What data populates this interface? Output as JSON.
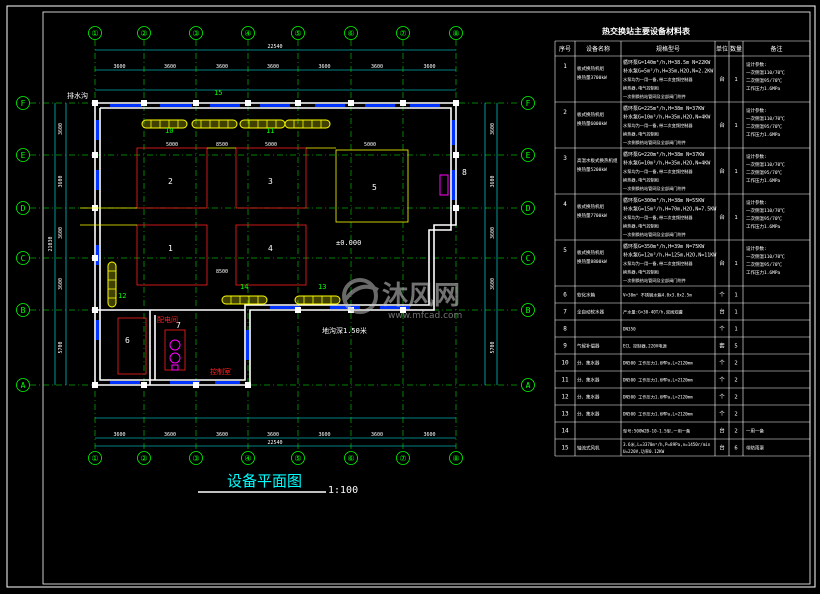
{
  "drawing": {
    "grid_columns": [
      "①",
      "②",
      "③",
      "④",
      "⑤",
      "⑥",
      "⑦",
      "⑧"
    ],
    "grid_rows": [
      "F",
      "E",
      "D",
      "C",
      "B",
      "A"
    ],
    "overall_width_dim": "22540",
    "top_dims": [
      "3600",
      "3600",
      "3600",
      "3600",
      "3600",
      "3600",
      "3600"
    ],
    "bottom_dims": [
      "3600",
      "3600",
      "3600",
      "3600",
      "3600",
      "3600",
      "3600"
    ],
    "left_dims": [
      "3600",
      "3600",
      "3600",
      "3600",
      "5700"
    ],
    "left_total": "21030",
    "right_dims": [
      "3600",
      "3600",
      "3600",
      "3600",
      "5700"
    ],
    "hx_widths": [
      "5000",
      "5000",
      "5000"
    ],
    "hx_heights": [
      "8500",
      "8500"
    ],
    "equipment_numbers": [
      "1",
      "2",
      "3",
      "4",
      "5",
      "6",
      "7",
      "8",
      "10",
      "11",
      "12",
      "13",
      "14",
      "15"
    ],
    "labels": {
      "corner_room": "排水沟",
      "level_mark": "±0.000",
      "trench_note": "地沟深1.50米",
      "room_a": "配电间",
      "room_b": "控制室"
    },
    "title": "设备平面图",
    "scale": "1:100"
  },
  "table": {
    "title": "热交换站主要设备材料表",
    "headers": [
      "序号",
      "设备名称",
      "规格型号",
      "单位",
      "数量",
      "备注"
    ],
    "rows": [
      {
        "no": "1",
        "name": "板式换热机组 换热量3700kW",
        "spec": [
          "循环泵G=140m³/h,H=38.5m N=22KW",
          "补水泵G=5m³/h,H=35m,H2O,N=2.2KW",
          "水泵均为一用一备,带二次变频控制器",
          "换热器,电气控制柜",
          "一次侧换热站管网及全部阀门附件"
        ],
        "unit": "台",
        "qty": "1",
        "remark": [
          "设计参数:",
          "一次侧温110/70℃",
          "二次侧温95/70℃",
          "工作压力1.6MPa"
        ]
      },
      {
        "no": "2",
        "name": "板式换热机组 换热量6000kW",
        "spec": [
          "循环泵G=225m³/h,H=38m N=37KW",
          "补水泵G=10m³/h,H=35m,H2O,N=4KW",
          "水泵均为一用一备,带二次变频控制器",
          "换热器,电气控制柜",
          "一次侧换热站管网及全部阀门附件"
        ],
        "unit": "台",
        "qty": "1",
        "remark": [
          "设计参数:",
          "一次侧温110/70℃",
          "二次侧温95/70℃",
          "工作压力1.6MPa"
        ]
      },
      {
        "no": "3",
        "name": "高温水板式换热机组 换热量5200kW",
        "spec": [
          "循环泵G=220m³/h,H=38m N=37KW",
          "补水泵G=10m³/h,H=35m,H2O,N=4KW",
          "水泵均为一用一备,带二次变频控制器",
          "换热器,电气控制柜",
          "一次侧换热站管网及全部阀门附件"
        ],
        "unit": "台",
        "qty": "1",
        "remark": [
          "设计参数:",
          "一次侧温110/70℃",
          "二次侧温95/70℃",
          "工作压力1.6MPa"
        ]
      },
      {
        "no": "4",
        "name": "板式换热机组 换热量7700kW",
        "spec": [
          "循环泵G=300m³/h,H=38m N=55KW",
          "补水泵G=15m³/h,H=70m,H2O,N=7.5KW",
          "水泵均为一用一备,带二次变频控制器",
          "换热器,电气控制柜",
          "一次侧换热站管网及全部阀门附件"
        ],
        "unit": "台",
        "qty": "1",
        "remark": [
          "设计参数:",
          "一次侧温110/70℃",
          "二次侧温95/70℃",
          "工作压力1.6MPa"
        ]
      },
      {
        "no": "5",
        "name": "板式换热机组 换热量8800kW",
        "spec": [
          "循环泵G=350m³/h,H=39m N=75KW",
          "补水泵G=12m³/h,H=125m,H2O,N=11KW",
          "水泵均为一用一备,带二次变频控制器",
          "换热器,电气控制柜",
          "一次侧换热站管网及全部阀门附件"
        ],
        "unit": "台",
        "qty": "1",
        "remark": [
          "设计参数:",
          "一次侧温110/70℃",
          "二次侧温95/70℃",
          "工作压力1.6MPa"
        ]
      },
      {
        "no": "6",
        "name": "软化水箱",
        "spec": [
          "V=30m³ 不锈钢水箱4.0x3.0x2.5m"
        ],
        "unit": "个",
        "qty": "1",
        "remark": []
      },
      {
        "no": "7",
        "name": "全自动软水器",
        "spec": [
          "产水量:G=30-40T/h,双阀双罐"
        ],
        "unit": "台",
        "qty": "1",
        "remark": []
      },
      {
        "no": "8",
        "name": "",
        "spec": [
          "DN350"
        ],
        "unit": "个",
        "qty": "1",
        "remark": []
      },
      {
        "no": "9",
        "name": "气候补偿器",
        "spec": [
          "ECL 控制器,220V电源"
        ],
        "unit": "套",
        "qty": "5",
        "remark": []
      },
      {
        "no": "10",
        "name": "分、集水器",
        "spec": [
          "DN500 工作压力1.6MPa,L=2120mm"
        ],
        "unit": "个",
        "qty": "2",
        "remark": []
      },
      {
        "no": "11",
        "name": "分、集水器",
        "spec": [
          "DN500 工作压力1.6MPa,L=2120mm"
        ],
        "unit": "个",
        "qty": "2",
        "remark": []
      },
      {
        "no": "12",
        "name": "分、集水器",
        "spec": [
          "DN500 工作压力1.6MPa,L=2120mm"
        ],
        "unit": "个",
        "qty": "2",
        "remark": []
      },
      {
        "no": "13",
        "name": "分、集水器",
        "spec": [
          "DN500 工作压力1.6MPa,L=2120mm"
        ],
        "unit": "个",
        "qty": "2",
        "remark": []
      },
      {
        "no": "14",
        "name": "",
        "spec": [
          "型号:500W2B-10-1.5型,一用一备"
        ],
        "unit": "台",
        "qty": "2",
        "remark": [
          "一用一备"
        ]
      },
      {
        "no": "15",
        "name": "轴流式风机",
        "spec": [
          "3.6米,L=3370m³/h,P=89Pa,n=1450r/min",
          "U=220V,功率0.12KW"
        ],
        "unit": "台",
        "qty": "6",
        "remark": [
          "带防雨罩"
        ]
      }
    ]
  },
  "watermark": {
    "main": "沐风网",
    "sub": "www.mfcad.com"
  },
  "colors": {
    "bg": "#000000",
    "grid": "#00ff00",
    "wall": "#ffffff",
    "window": "#0000ff",
    "dim": "#00ffff",
    "red": "#ff2020",
    "yellow": "#ffff00",
    "magenta": "#ff00ff"
  }
}
